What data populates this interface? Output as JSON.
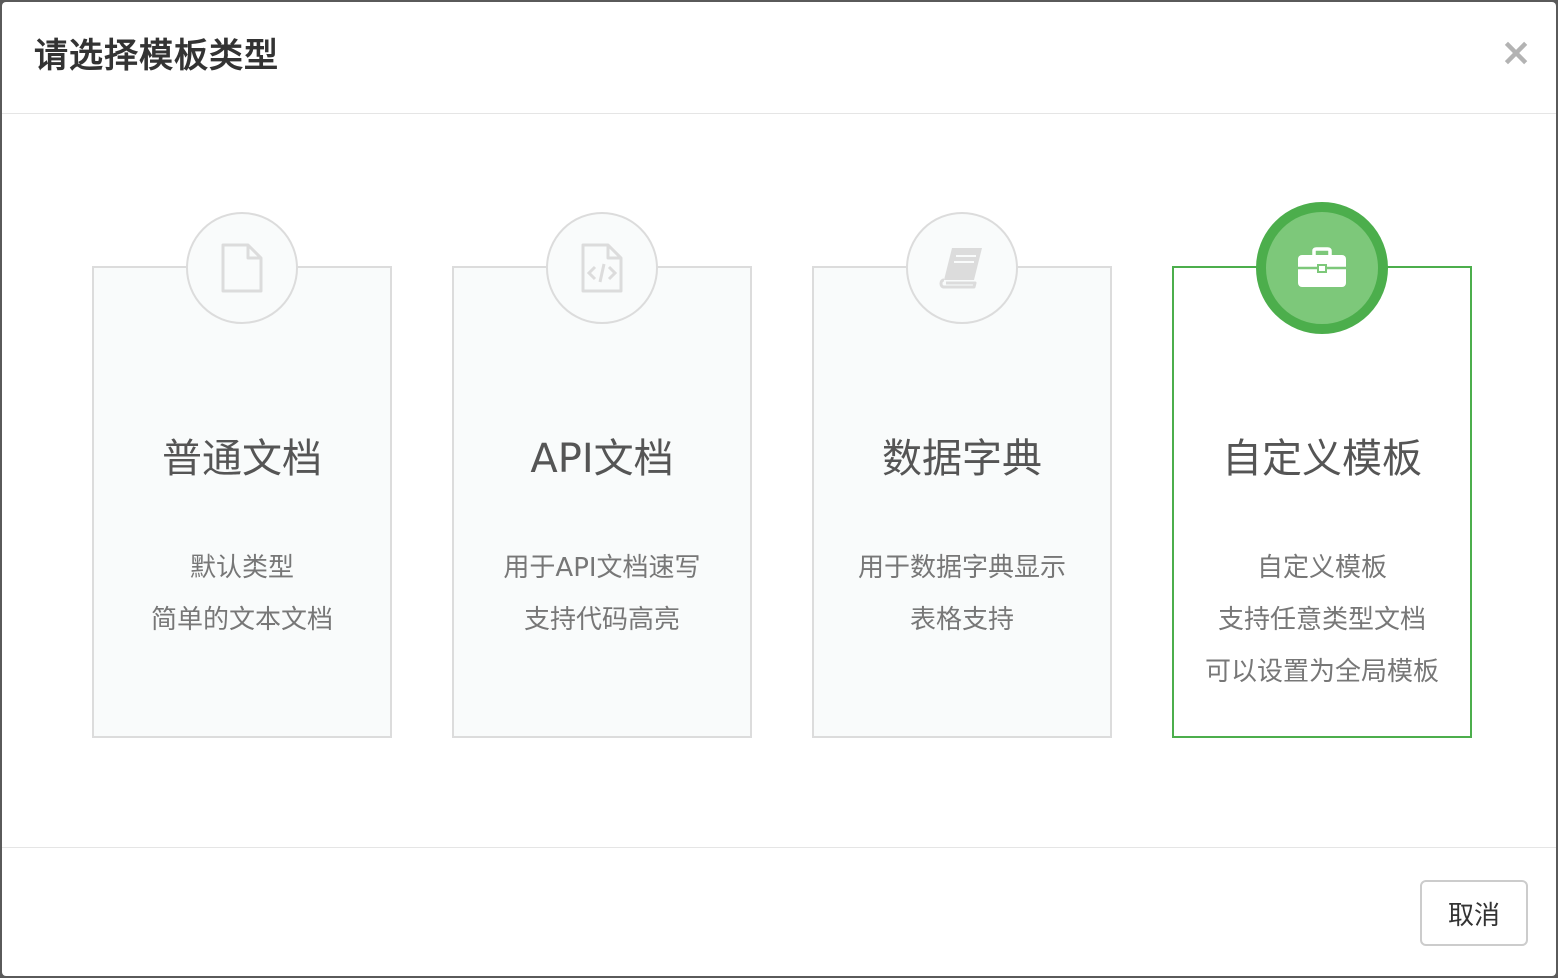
{
  "dialog": {
    "title": "请选择模板类型",
    "close_label": "×"
  },
  "templates": [
    {
      "icon": "file-icon",
      "title": "普通文档",
      "description": [
        "默认类型",
        "简单的文本文档"
      ],
      "selected": false
    },
    {
      "icon": "code-file-icon",
      "title": "API文档",
      "description": [
        "用于API文档速写",
        "支持代码高亮"
      ],
      "selected": false
    },
    {
      "icon": "book-icon",
      "title": "数据字典",
      "description": [
        "用于数据字典显示",
        "表格支持"
      ],
      "selected": false
    },
    {
      "icon": "briefcase-icon",
      "title": "自定义模板",
      "description": [
        "自定义模板",
        "支持任意类型文档",
        "可以设置为全局模板"
      ],
      "selected": true
    }
  ],
  "footer": {
    "cancel_label": "取消"
  },
  "colors": {
    "accent_green": "#4cae4c",
    "accent_green_light": "#7dc87a",
    "card_border": "#dcdcdc"
  }
}
